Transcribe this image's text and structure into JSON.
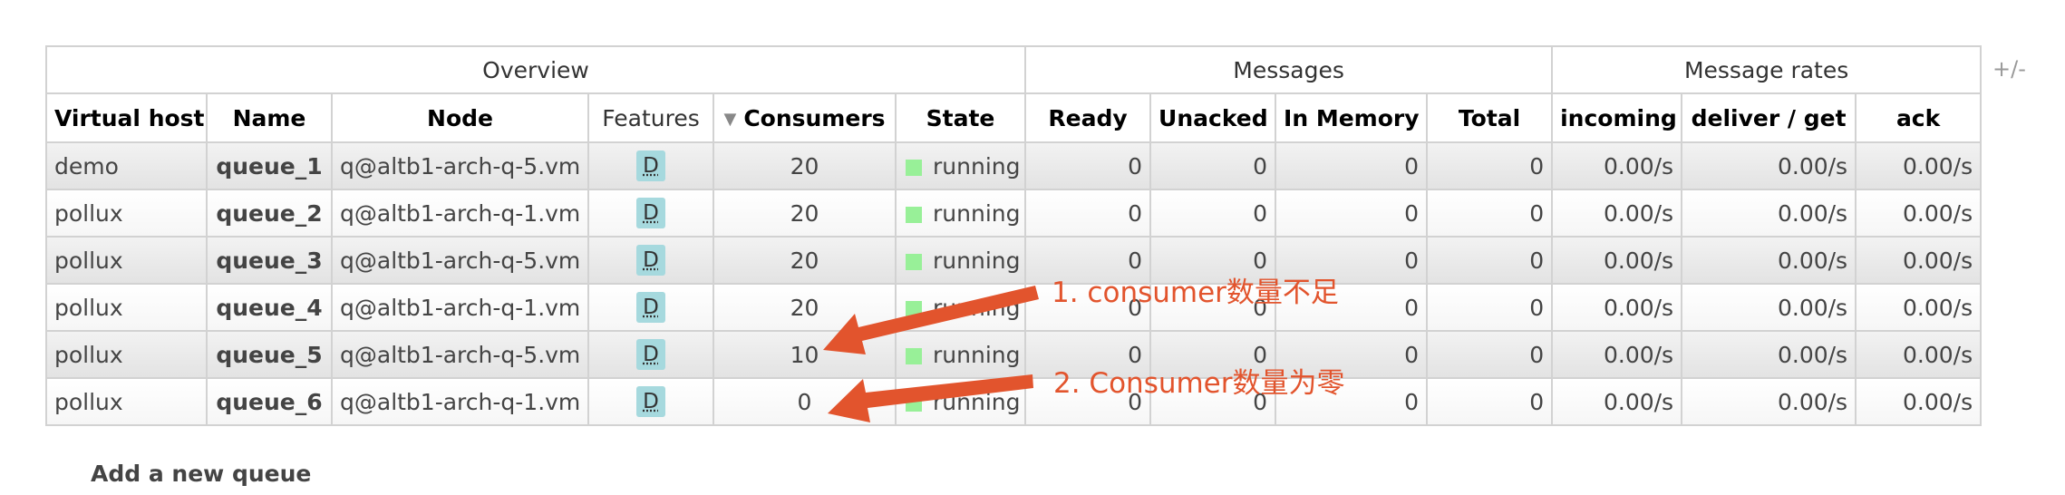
{
  "table": {
    "groups": [
      "Overview",
      "Messages",
      "Message rates"
    ],
    "columns": {
      "vhost": "Virtual host",
      "name": "Name",
      "node": "Node",
      "features": "Features",
      "consumers": "Consumers",
      "state": "State",
      "ready": "Ready",
      "unacked": "Unacked",
      "in_memory": "In Memory",
      "total": "Total",
      "incoming": "incoming",
      "deliver_get": "deliver / get",
      "ack": "ack"
    },
    "sort_indicator": "▼",
    "rows": [
      {
        "vhost": "demo",
        "name": "queue_1",
        "node": "q@altb1-arch-q-5.vm",
        "feature": "D",
        "consumers": "20",
        "state": "running",
        "ready": "0",
        "unacked": "0",
        "in_memory": "0",
        "total": "0",
        "incoming": "0.00/s",
        "deliver_get": "0.00/s",
        "ack": "0.00/s"
      },
      {
        "vhost": "pollux",
        "name": "queue_2",
        "node": "q@altb1-arch-q-1.vm",
        "feature": "D",
        "consumers": "20",
        "state": "running",
        "ready": "0",
        "unacked": "0",
        "in_memory": "0",
        "total": "0",
        "incoming": "0.00/s",
        "deliver_get": "0.00/s",
        "ack": "0.00/s"
      },
      {
        "vhost": "pollux",
        "name": "queue_3",
        "node": "q@altb1-arch-q-5.vm",
        "feature": "D",
        "consumers": "20",
        "state": "running",
        "ready": "0",
        "unacked": "0",
        "in_memory": "0",
        "total": "0",
        "incoming": "0.00/s",
        "deliver_get": "0.00/s",
        "ack": "0.00/s"
      },
      {
        "vhost": "pollux",
        "name": "queue_4",
        "node": "q@altb1-arch-q-1.vm",
        "feature": "D",
        "consumers": "20",
        "state": "running",
        "ready": "0",
        "unacked": "0",
        "in_memory": "0",
        "total": "0",
        "incoming": "0.00/s",
        "deliver_get": "0.00/s",
        "ack": "0.00/s"
      },
      {
        "vhost": "pollux",
        "name": "queue_5",
        "node": "q@altb1-arch-q-5.vm",
        "feature": "D",
        "consumers": "10",
        "state": "running",
        "ready": "0",
        "unacked": "0",
        "in_memory": "0",
        "total": "0",
        "incoming": "0.00/s",
        "deliver_get": "0.00/s",
        "ack": "0.00/s"
      },
      {
        "vhost": "pollux",
        "name": "queue_6",
        "node": "q@altb1-arch-q-1.vm",
        "feature": "D",
        "consumers": "0",
        "state": "running",
        "ready": "0",
        "unacked": "0",
        "in_memory": "0",
        "total": "0",
        "incoming": "0.00/s",
        "deliver_get": "0.00/s",
        "ack": "0.00/s"
      }
    ]
  },
  "plus_minus": "+/-",
  "add_queue": "Add a new queue",
  "annotations": [
    "1. consumer数量不足",
    "2. Consumer数量为零"
  ],
  "colors": {
    "annotation": "#e2542d",
    "feature_badge": "#a6d9de",
    "running_state": "#98f098"
  }
}
